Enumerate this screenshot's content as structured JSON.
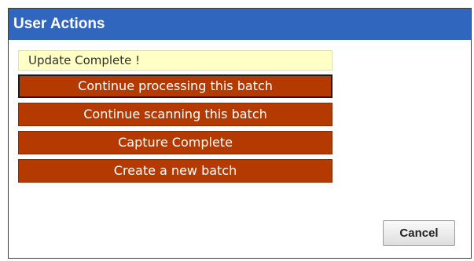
{
  "dialog": {
    "title": "User Actions"
  },
  "status": {
    "message": "Update Complete !"
  },
  "actions": [
    {
      "label": "Continue processing this batch"
    },
    {
      "label": "Continue scanning this batch"
    },
    {
      "label": "Capture Complete"
    },
    {
      "label": "Create a new batch"
    }
  ],
  "footer": {
    "cancel_label": "Cancel"
  },
  "colors": {
    "titlebar": "#3166bf",
    "action_button": "#b43a02",
    "status_background": "#ffffc6"
  }
}
